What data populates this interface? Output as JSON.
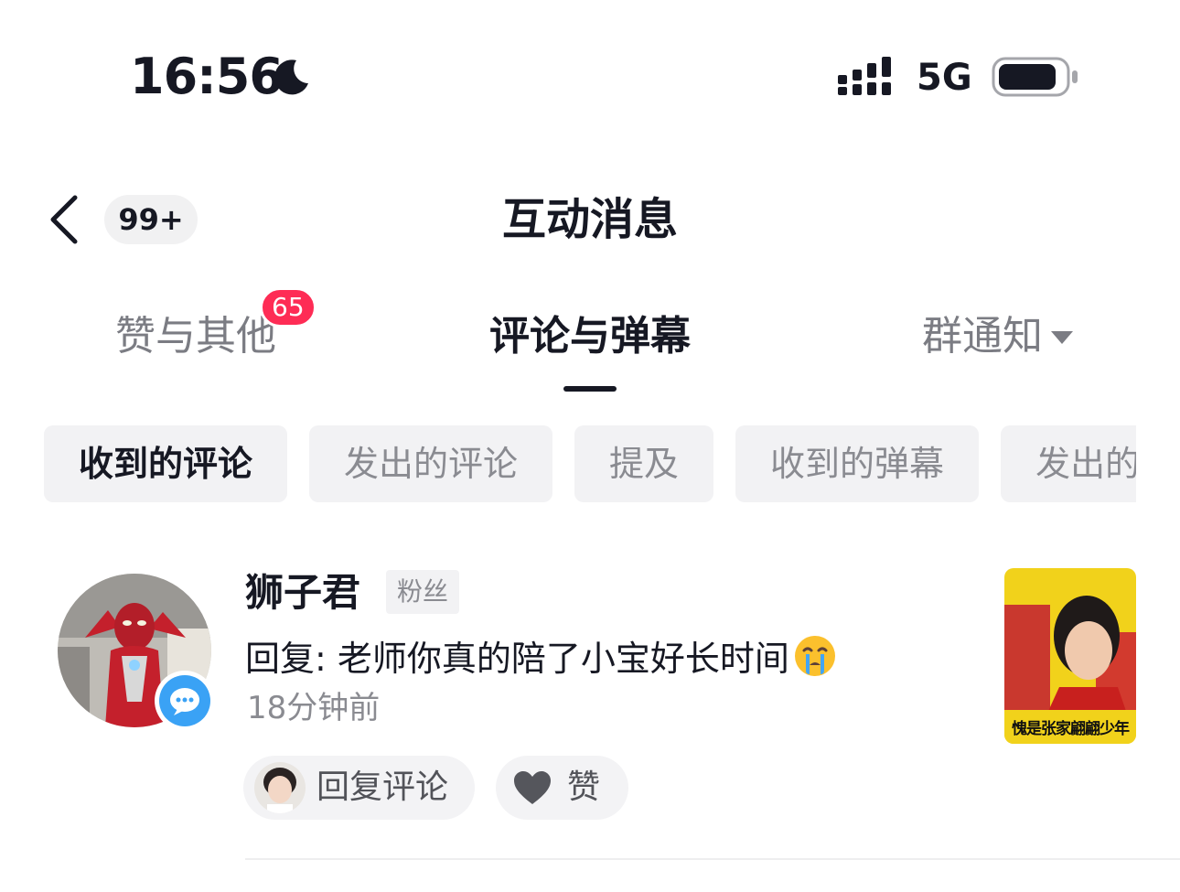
{
  "status_bar": {
    "time": "16:56",
    "moon_icon": "moon-icon",
    "signal_icon": "signal-icon",
    "network": "5G",
    "battery_icon": "battery-icon"
  },
  "nav": {
    "back_icon": "chevron-left-icon",
    "unread_count": "99+",
    "title": "互动消息"
  },
  "tabs": [
    {
      "label": "赞与其他",
      "badge": "65",
      "active": false
    },
    {
      "label": "评论与弹幕",
      "active": true
    },
    {
      "label": "群通知",
      "dropdown_icon": "caret-down-icon",
      "active": false
    }
  ],
  "filters": [
    {
      "label": "收到的评论",
      "active": true
    },
    {
      "label": "发出的评论",
      "active": false
    },
    {
      "label": "提及",
      "active": false
    },
    {
      "label": "收到的弹幕",
      "active": false
    },
    {
      "label": "发出的弹幕",
      "active": false
    }
  ],
  "comments": [
    {
      "username": "狮子君",
      "tag": "粉丝",
      "content": "回复: 老师你真的陪了小宝好长时间",
      "emoji": "crying-face-emoji",
      "time": "18分钟前",
      "thumbnail_caption": "愧是张家翩翩少年",
      "reply_label": "回复评论",
      "like_label": "赞",
      "colors": {
        "accent_badge": "#fe2c55",
        "chat_badge": "#3aa2f5"
      }
    }
  ]
}
